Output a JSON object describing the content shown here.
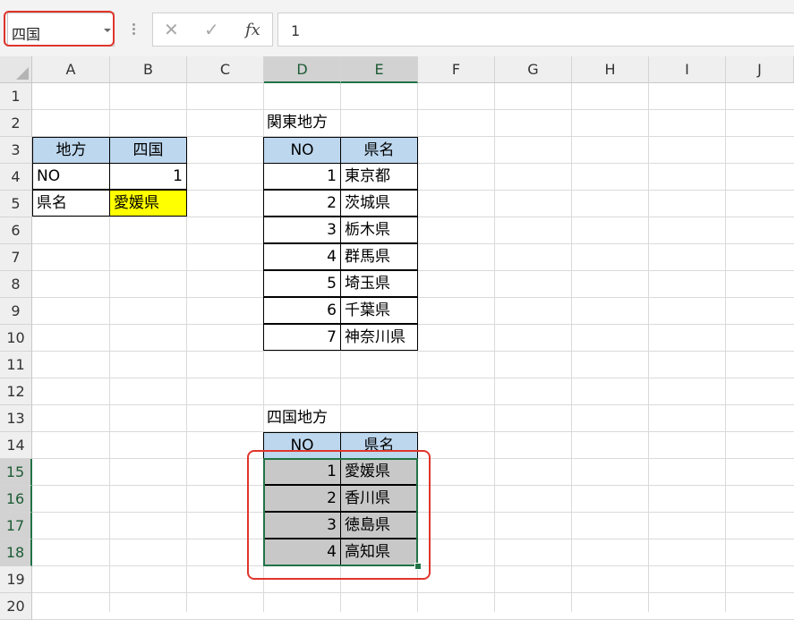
{
  "formula_bar": {
    "name_box": "四国",
    "formula_value": "1",
    "cancel_glyph": "✕",
    "enter_glyph": "✓",
    "fx_label": "fx"
  },
  "columns": [
    "A",
    "B",
    "C",
    "D",
    "E",
    "F",
    "G",
    "H",
    "I",
    "J"
  ],
  "rows": [
    "1",
    "2",
    "3",
    "4",
    "5",
    "6",
    "7",
    "8",
    "9",
    "10",
    "11",
    "12",
    "13",
    "14",
    "15",
    "16",
    "17",
    "18",
    "19",
    "20"
  ],
  "left_table": {
    "header": [
      "地方",
      "四国"
    ],
    "rows": [
      [
        "NO",
        "1"
      ],
      [
        "県名",
        "愛媛県"
      ]
    ]
  },
  "kanto": {
    "title": "関東地方",
    "header": [
      "NO",
      "県名"
    ],
    "rows": [
      [
        "1",
        "東京都"
      ],
      [
        "2",
        "茨城県"
      ],
      [
        "3",
        "栃木県"
      ],
      [
        "4",
        "群馬県"
      ],
      [
        "5",
        "埼玉県"
      ],
      [
        "6",
        "千葉県"
      ],
      [
        "7",
        "神奈川県"
      ]
    ]
  },
  "shikoku": {
    "title": "四国地方",
    "header": [
      "NO",
      "県名"
    ],
    "rows": [
      [
        "1",
        "愛媛県"
      ],
      [
        "2",
        "香川県"
      ],
      [
        "3",
        "徳島県"
      ],
      [
        "4",
        "高知県"
      ]
    ]
  },
  "colors": {
    "header_fill": "#bdd7ee",
    "highlight_fill": "#ffff00",
    "selection_fill": "#c8c8c8",
    "excel_green": "#217346",
    "callout_red": "#e0352b"
  }
}
